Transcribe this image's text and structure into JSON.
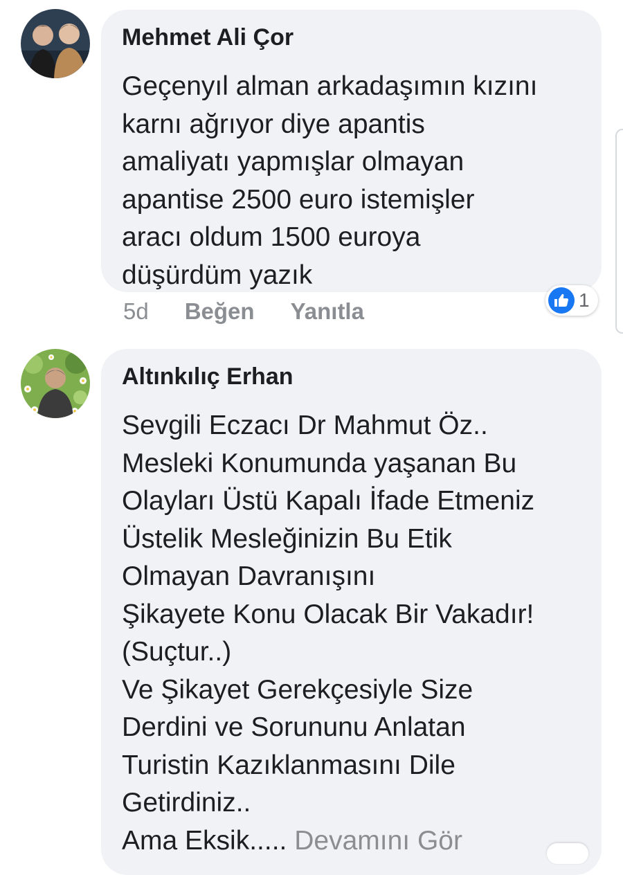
{
  "comments": [
    {
      "author": "Mehmet Ali Çor",
      "lines": [
        "Geçenyıl alman arkadaşımın kızını",
        "karnı ağrıyor diye apantis",
        "amaliyatı yapmışlar olmayan",
        "apantise 2500 euro istemişler",
        "aracı oldum 1500 euroya",
        "düşürdüm yazık"
      ],
      "time": "5d",
      "like_label": "Beğen",
      "reply_label": "Yanıtla",
      "reaction_count": "1",
      "reaction_icon": "like-icon"
    },
    {
      "author": "Altınkılıç Erhan",
      "lines": [
        "Sevgili Eczacı Dr Mahmut Öz..",
        "Mesleki Konumunda yaşanan Bu",
        "Olayları Üstü Kapalı İfade Etmeniz",
        "Üstelik Mesleğinizin Bu Etik",
        "Olmayan Davranışını",
        "Şikayete Konu Olacak Bir Vakadır!",
        "(Suçtur..)",
        "Ve Şikayet Gerekçesiyle Size",
        "Derdini ve Sorununu Anlatan",
        "Turistin Kazıklanmasını Dile",
        "Getirdiniz.."
      ],
      "last_line_text": "Ama Eksik.....",
      "see_more_label": "Devamını Gör"
    }
  ],
  "colors": {
    "bubble_bg": "#f0f2f5",
    "text": "#1c1e21",
    "muted": "#8a8d91",
    "like_blue": "#1877f2"
  }
}
